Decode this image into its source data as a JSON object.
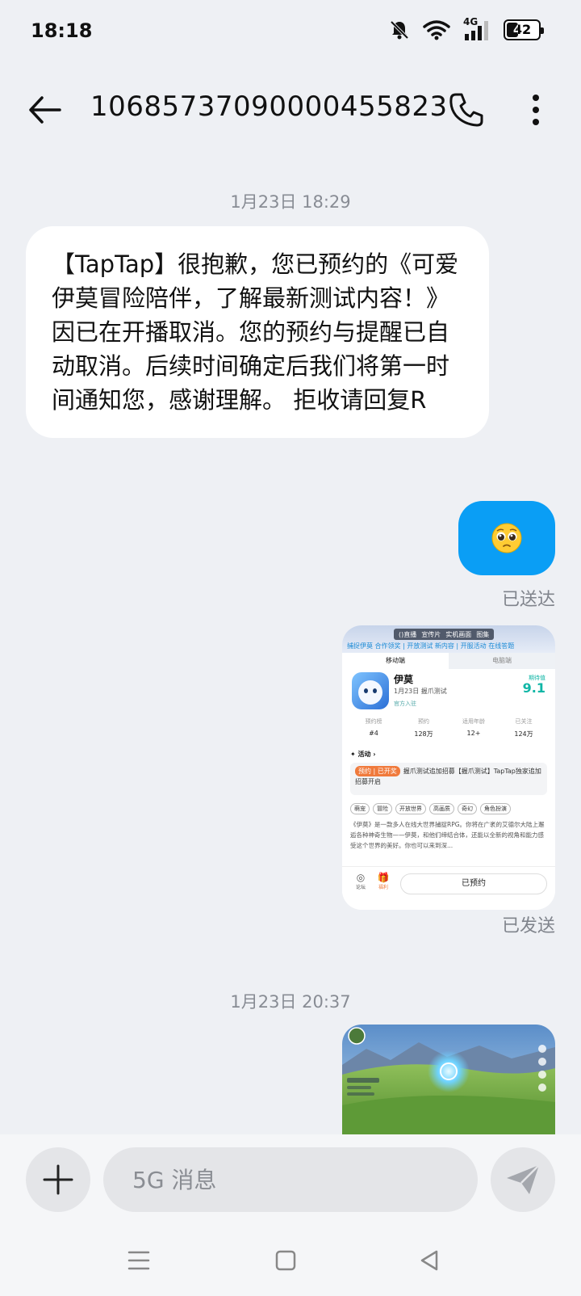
{
  "status_bar": {
    "time": "18:18",
    "network": "4G",
    "battery": "42",
    "icons": [
      "mute-bell-icon",
      "wifi-icon",
      "signal-icon",
      "battery-icon"
    ]
  },
  "header": {
    "title": "10685737090000455823",
    "icons": [
      "back-arrow-icon",
      "phone-icon",
      "more-vertical-icon"
    ]
  },
  "conversation": {
    "date_1": "1月23日 18:29",
    "incoming_message": "【TapTap】很抱歉，您已预约的《可爱伊莫冒险陪伴，了解最新测试内容！》因已在开播取消。您的预约与提醒已自动取消。后续时间确定后我们将第一时间通知您，感谢理解。 拒收请回复R",
    "emoji_message": "🥺",
    "status_delivered": "已送达",
    "status_sent": "已发送",
    "date_2": "1月23日 20:37"
  },
  "attachment_screenshot": {
    "top_tabs": [
      "()直播",
      "宣传片",
      "实机画面",
      "图集"
    ],
    "headline": "捕捉伊莫 合作领奖 | 开放测试 新内容 | 开服活动 在线答题",
    "platform_tabs": [
      "移动端",
      "电脑端"
    ],
    "app_name": "伊莫",
    "app_subtitle": "1月23日 握爪测试",
    "official_label": "官方入驻",
    "score_label": "期待值",
    "score_value": "9.1",
    "stats": [
      {
        "label": "预约榜",
        "value": "#4"
      },
      {
        "label": "预约",
        "value": "128万"
      },
      {
        "label": "适用年龄",
        "value": "12+"
      },
      {
        "label": "已关注",
        "value": "124万"
      }
    ],
    "activity_title": "活动",
    "activity_badge": "预约 | 已开奖",
    "activity_text": "握爪测试追加招募【握爪测试】TapTap独家追加招募开启",
    "tags": [
      "萌宠",
      "冒险",
      "开放世界",
      "高画质",
      "奇幻",
      "角色扮演"
    ],
    "description": "《伊莫》是一款多人在线大世界捕捉RPG。你将在广袤的艾德尔大陆上邂逅各种神奇生物——伊莫，和他们缔结合体，还能以全新的视角和能力感受这个世界的美好。你也可以来到深...",
    "bottom_labels": [
      "论坛",
      "福利"
    ],
    "reserved_button": "已预约"
  },
  "input_bar": {
    "placeholder": "5G 消息",
    "icons": [
      "plus-icon",
      "send-icon"
    ]
  },
  "nav_bar": {
    "icons": [
      "menu-lines-icon",
      "home-square-icon",
      "back-triangle-icon"
    ]
  },
  "colors": {
    "background": "#eef0f4",
    "outgoing_bubble": "#0a9ef5",
    "incoming_bubble": "#ffffff",
    "score": "#10b6a6"
  }
}
